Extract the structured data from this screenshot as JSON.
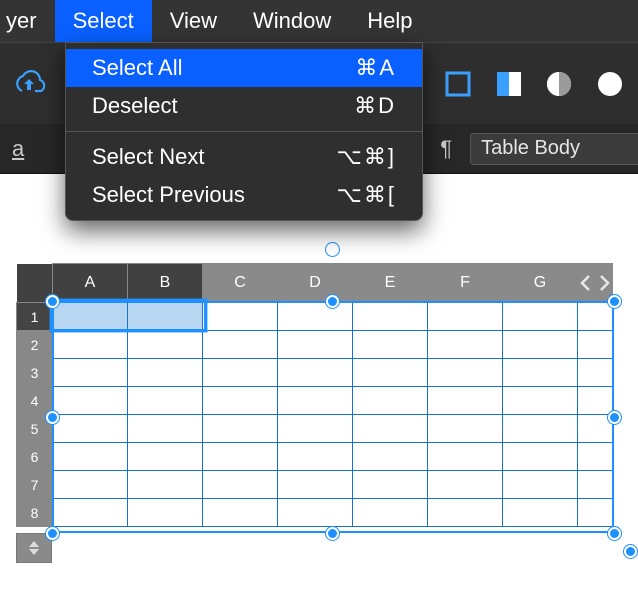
{
  "menubar": {
    "items": [
      {
        "label": "yer"
      },
      {
        "label": "Select",
        "active": true
      },
      {
        "label": "View"
      },
      {
        "label": "Window"
      },
      {
        "label": "Help"
      }
    ]
  },
  "dropdown": {
    "items": [
      {
        "label": "Select All",
        "shortcut": "⌘A",
        "highlight": true
      },
      {
        "label": "Deselect",
        "shortcut": "⌘D"
      },
      {
        "separator": true
      },
      {
        "label": "Select Next",
        "shortcut": "⌥⌘]"
      },
      {
        "label": "Select Previous",
        "shortcut": "⌥⌘["
      }
    ]
  },
  "toolbar": {
    "upload_icon": "arrow-up-cloud",
    "shapes": [
      "square-outline",
      "square-filled",
      "circle-outline",
      "circle-filled"
    ]
  },
  "optbar": {
    "a_label": "a",
    "pilcrow": "¶",
    "style_label": "Table Body"
  },
  "table": {
    "columns": [
      "A",
      "B",
      "C",
      "D",
      "E",
      "F",
      "G"
    ],
    "rows": [
      "1",
      "2",
      "3",
      "4",
      "5",
      "6",
      "7",
      "8"
    ],
    "active_cols": [
      "A",
      "B"
    ],
    "active_rows": [
      "1"
    ],
    "selection": {
      "cols": [
        "A",
        "B"
      ],
      "row": "1"
    }
  },
  "colors": {
    "menu_active": "#0a60ff",
    "selection": "#1e90ff",
    "sel_fill": "#b7d6f2"
  }
}
